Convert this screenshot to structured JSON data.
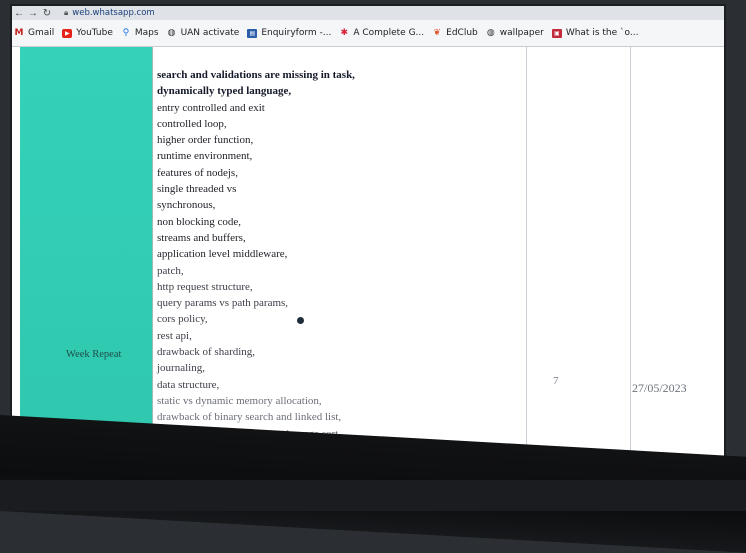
{
  "browser": {
    "url": "web.whatsapp.com",
    "bookmarks": [
      {
        "label": "Gmail",
        "icon": "gmail-icon"
      },
      {
        "label": "YouTube",
        "icon": "youtube-icon"
      },
      {
        "label": "Maps",
        "icon": "maps-icon"
      },
      {
        "label": "UAN activate",
        "icon": "globe-icon"
      },
      {
        "label": "Enquiryform -...",
        "icon": "form-icon"
      },
      {
        "label": "A Complete G...",
        "icon": "asterisk-icon"
      },
      {
        "label": "EdClub",
        "icon": "edclub-icon"
      },
      {
        "label": "wallpaper",
        "icon": "globe-icon"
      },
      {
        "label": "What is the `o...",
        "icon": "bookmark-icon"
      }
    ]
  },
  "table": {
    "row_label": "Week Repeat",
    "topics": [
      "search and validations are missing in task,",
      "dynamically typed language,",
      "entry controlled and exit",
      "controlled loop,",
      "higher order function,",
      "runtime environment,",
      "features of nodejs,",
      "single threaded vs",
      "synchronous,",
      "non blocking code,",
      "streams and buffers,",
      "application level middleware,",
      "patch,",
      "http request structure,",
      "query params vs path params,",
      "cors policy,",
      "rest api,",
      "drawback of sharding,",
      "journaling,",
      "data structure,",
      "static vs dynamic memory allocation,",
      "drawback of binary search and linked list,",
      "complexity of bubble sort and merge sort."
    ],
    "count": "7",
    "date": "27/05/2023"
  }
}
